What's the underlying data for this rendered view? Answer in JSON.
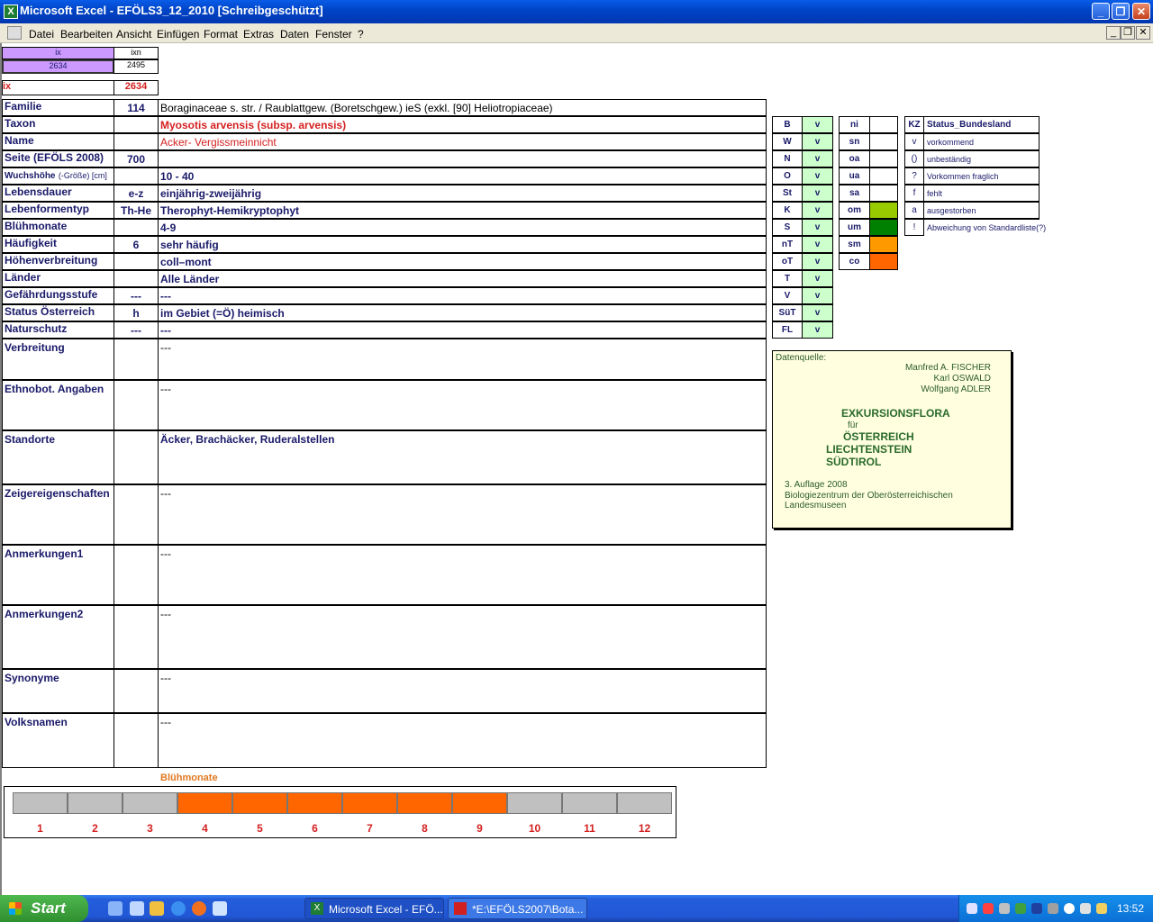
{
  "window": {
    "title": "Microsoft Excel - EFÖLS3_12_2010  [Schreibgeschützt]"
  },
  "menu": [
    "Datei",
    "Bearbeiten",
    "Ansicht",
    "Einfügen",
    "Format",
    "Extras",
    "Daten",
    "Fenster",
    "?"
  ],
  "index_box": {
    "h1": "ix",
    "h2": "ixn",
    "v1": "2634",
    "v2": "2495",
    "ix_label": "ix",
    "ix_value": "2634"
  },
  "rows": [
    {
      "label": "Familie",
      "code": "114",
      "value": "Boraginaceae s. str.  /  Raublattgew. (Boretschgew.) ieS (exkl. [90] Heliotropiaceae)"
    },
    {
      "label": "Taxon",
      "code": "",
      "value": "Myosotis arvensis (subsp. arvensis)"
    },
    {
      "label": "Name",
      "code": "",
      "value": "Acker- Vergissmeinnicht"
    },
    {
      "label": "Seite (EFÖLS 2008)",
      "code": "700",
      "value": ""
    },
    {
      "label": "Wuchshöhe",
      "label_suffix": "(-Größe) [cm]",
      "code": "",
      "value": "10 - 40"
    },
    {
      "label": "Lebensdauer",
      "code": "e-z",
      "value": "einjährig-zweijährig"
    },
    {
      "label": "Lebenformentyp",
      "code": "Th-He",
      "value": "Therophyt-Hemikryptophyt"
    },
    {
      "label": "Blühmonate",
      "code": "",
      "value": "4-9"
    },
    {
      "label": "Häufigkeit",
      "code": "6",
      "value": "sehr häufig"
    },
    {
      "label": "Höhenverbreitung",
      "code": "",
      "value": "coll–mont"
    },
    {
      "label": "Länder",
      "code": "",
      "value": "Alle Länder"
    },
    {
      "label": "Gefährdungsstufe",
      "code": "---",
      "value": "---"
    },
    {
      "label": "Status Österreich",
      "code": "h",
      "value": "im Gebiet (=Ö) heimisch"
    },
    {
      "label": "Naturschutz",
      "code": "---",
      "value": "---"
    }
  ],
  "tall_rows": [
    {
      "label": "Verbreitung",
      "value": "---"
    },
    {
      "label": "Ethnobot. Angaben",
      "value": "---"
    },
    {
      "label": "Standorte",
      "value": "Äcker, Brachäcker, Ruderalstellen"
    },
    {
      "label": "Zeigereigenschaften",
      "value": "---"
    },
    {
      "label": "Anmerkungen1",
      "value": "---"
    },
    {
      "label": "Anmerkungen2",
      "value": "---"
    },
    {
      "label": "Synonyme",
      "value": "---"
    },
    {
      "label": "Volksnamen",
      "value": "---"
    }
  ],
  "states": [
    {
      "k": "B",
      "v": "v"
    },
    {
      "k": "W",
      "v": "v"
    },
    {
      "k": "N",
      "v": "v"
    },
    {
      "k": "O",
      "v": "v"
    },
    {
      "k": "St",
      "v": "v"
    },
    {
      "k": "K",
      "v": "v"
    },
    {
      "k": "S",
      "v": "v"
    },
    {
      "k": "nT",
      "v": "v"
    },
    {
      "k": "oT",
      "v": "v"
    },
    {
      "k": "T",
      "v": "v"
    },
    {
      "k": "V",
      "v": "v"
    },
    {
      "k": "SüT",
      "v": "v"
    },
    {
      "k": "FL",
      "v": "v"
    }
  ],
  "zones": [
    {
      "k": "ni",
      "color": "#ffffff"
    },
    {
      "k": "sn",
      "color": "#ffffff"
    },
    {
      "k": "oa",
      "color": "#ffffff"
    },
    {
      "k": "ua",
      "color": "#ffffff"
    },
    {
      "k": "sa",
      "color": "#ffffff"
    },
    {
      "k": "om",
      "color": "#99cc00"
    },
    {
      "k": "um",
      "color": "#008000"
    },
    {
      "k": "sm",
      "color": "#ff9900"
    },
    {
      "k": "co",
      "color": "#ff6600"
    }
  ],
  "status_legend": {
    "header_kz": "KZ",
    "header_title": "Status_Bundesland",
    "items": [
      {
        "k": "v",
        "t": "vorkommend"
      },
      {
        "k": "()",
        "t": "unbeständig"
      },
      {
        "k": "?",
        "t": "Vorkommen fraglich"
      },
      {
        "k": "f",
        "t": "fehlt"
      },
      {
        "k": "a",
        "t": "ausgestorben"
      },
      {
        "k": "!",
        "t": "Abweichung von Standardliste(?)"
      }
    ]
  },
  "source": {
    "label": "Datenquelle:",
    "authors": [
      "Manfred A. FISCHER",
      "Karl OSWALD",
      "Wolfgang ADLER"
    ],
    "book": "EXKURSIONSFLORA",
    "fuer": "für",
    "c1": "ÖSTERREICH",
    "c2": "LIECHTENSTEIN",
    "c3": "SÜDTIROL",
    "edition": "3. Auflage 2008",
    "publisher": "Biologiezentrum der Oberösterreichischen Landesmuseen"
  },
  "bloom": {
    "title": "Blühmonate",
    "months": [
      "1",
      "2",
      "3",
      "4",
      "5",
      "6",
      "7",
      "8",
      "9",
      "10",
      "11",
      "12"
    ],
    "blooming": [
      false,
      false,
      false,
      true,
      true,
      true,
      true,
      true,
      true,
      false,
      false,
      false
    ],
    "on_color": "#ff6600",
    "off_color": "#c0c0c0"
  },
  "taskbar": {
    "start": "Start",
    "tasks": [
      "Microsoft Excel - EFÖ...",
      "*E:\\EFÖLS2007\\Bota..."
    ],
    "clock": "13:52"
  }
}
